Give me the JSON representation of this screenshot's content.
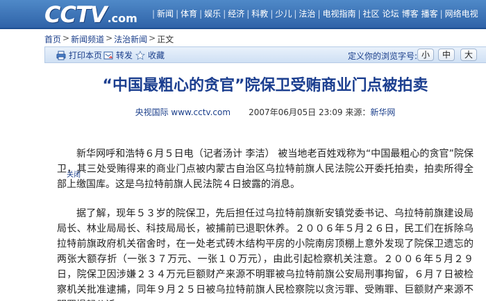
{
  "header": {
    "logo": {
      "main": "CCTV",
      "suffix": ".com"
    },
    "nav": [
      "新闻",
      "体育",
      "娱乐",
      "经济",
      "科教",
      "少儿",
      "法治",
      "电视指南",
      "社区",
      "论坛",
      "博客",
      "播客",
      "网络电视"
    ]
  },
  "breadcrumb": {
    "items": [
      "首页",
      "新闻频道",
      "法治新闻"
    ],
    "current": "正文"
  },
  "toolbar": {
    "print_label": "打印本页",
    "forward_label": "转发",
    "favorite_label": "收藏",
    "font_size_label": "定义你的浏览字号:",
    "font_small": "小",
    "font_medium": "中",
    "font_large": "大"
  },
  "article": {
    "title": "“中国最粗心的贪官”院保卫受贿商业门点被拍卖",
    "source_site": "央视国际 www.cctv.com",
    "datetime": "2007年06月05日 23:09",
    "source_label": "来源：",
    "source_name": "新华网",
    "paragraphs": [
      "新华网呼和浩特６月５日电（记者汤计 李洁） 被当地老百姓戏称为“中国最粗心的贪官”院保卫，其三处受贿得来的商业门点被内蒙古自治区乌拉特前旗人民法院公开委托拍卖，拍卖所得全部上缴国库。这是乌拉特前旗人民法院４日披露的消息。",
      "据了解，现年５３岁的院保卫，先后担任过乌拉特前旗新安镇党委书记、乌拉特前旗建设局局长、林业局局长、科技局局长，被捕前已退职休养。２００６年５月２６日，民工们在拆除乌拉特前旗政府机关宿舍时，在一处老式砖木结构平房的小院南房顶棚上意外发现了院保卫遗忘的两张大额存折（一张３７万元、一张１０万元），由此引起检察机关注意。２００６年５月２９日，院保卫因涉嫌２３４万元巨额财产来源不明罪被乌拉特前旗公安局刑事拘留，６月７日被检察机关批准逮捕，同年９月２５日被乌拉特前旗人民检察院以贪污罪、受贿罪、巨额财产来源不明罪提起公诉。"
    ],
    "close_label": "关闭"
  },
  "colors": {
    "header_blue": "#2f63a8",
    "title_blue": "#1b3e8f",
    "link_blue": "#1b3f8b",
    "toolbar_bg": "#dce8f7"
  },
  "icons": [
    "printer-icon",
    "forward-icon",
    "star-icon"
  ]
}
